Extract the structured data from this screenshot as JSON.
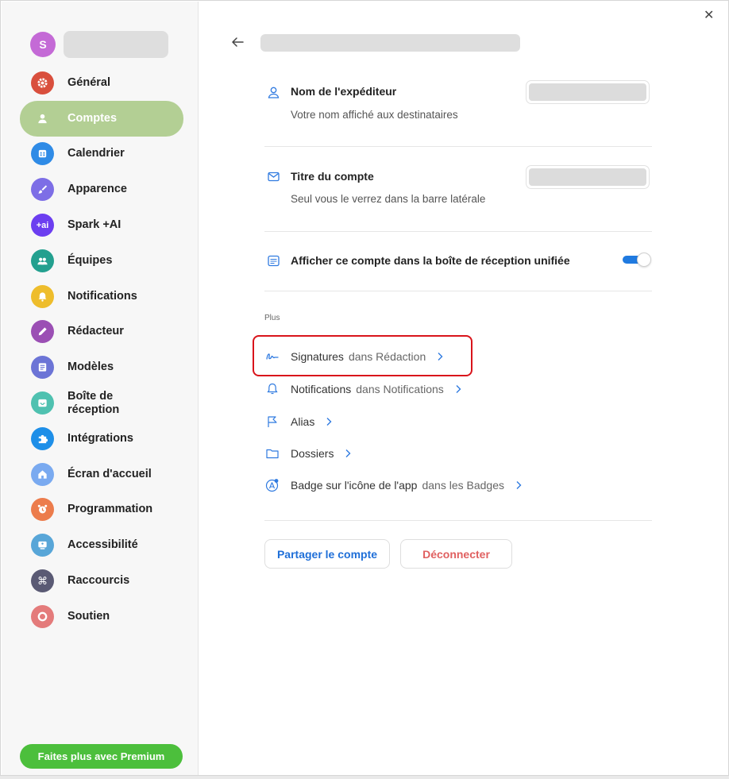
{
  "user": {
    "initial": "S"
  },
  "sidebar": {
    "items": [
      {
        "label": "Général",
        "icon": "gear-icon",
        "color": "#d94f3d"
      },
      {
        "label": "Comptes",
        "icon": "person-icon",
        "color": "#b3cf94",
        "active": true
      },
      {
        "label": "Calendrier",
        "icon": "calendar-icon",
        "color": "#2f8be6"
      },
      {
        "label": "Apparence",
        "icon": "paint-brush-icon",
        "color": "#7d6ee6"
      },
      {
        "label": "Spark +AI",
        "icon": "ai-icon",
        "text": "+ai",
        "color": "#6c3ef0"
      },
      {
        "label": "Équipes",
        "icon": "team-icon",
        "color": "#23a08f"
      },
      {
        "label": "Notifications",
        "icon": "bell-icon",
        "color": "#eebd2c"
      },
      {
        "label": "Rédacteur",
        "icon": "pencil-icon",
        "color": "#9b4fb4"
      },
      {
        "label": "Modèles",
        "icon": "template-icon",
        "color": "#6c74d6"
      },
      {
        "label": "Boîte de\nréception",
        "icon": "inbox-icon",
        "color": "#4fc1b0"
      },
      {
        "label": "Intégrations",
        "icon": "puzzle-icon",
        "color": "#1e8fe8"
      },
      {
        "label": "Écran d'accueil",
        "icon": "home-icon",
        "color": "#7aaaf0"
      },
      {
        "label": "Programmation",
        "icon": "alarm-clock-icon",
        "color": "#ec7c4c"
      },
      {
        "label": "Accessibilité",
        "icon": "accessibility-icon",
        "color": "#58a6d8"
      },
      {
        "label": "Raccourcis",
        "icon": "command-icon",
        "color": "#5a5a74"
      },
      {
        "label": "Soutien",
        "icon": "support-icon",
        "color": "#e47b7b"
      }
    ],
    "premium_label": "Faites plus avec Premium"
  },
  "account": {
    "sender_name": {
      "title": "Nom de l'expéditeur",
      "subtitle": "Votre nom affiché aux destinataires"
    },
    "account_title": {
      "title": "Titre du compte",
      "subtitle": "Seul vous le verrez dans la barre latérale"
    },
    "unified_inbox": {
      "label": "Afficher ce compte dans la boîte de réception unifiée",
      "enabled": true
    }
  },
  "more": {
    "section_label": "Plus",
    "links": [
      {
        "main": "Signatures",
        "sub": "dans Rédaction",
        "icon": "signature-icon"
      },
      {
        "main": "Notifications",
        "sub": "dans Notifications",
        "icon": "bell-icon"
      },
      {
        "main": "Alias",
        "sub": "",
        "icon": "alias-icon"
      },
      {
        "main": "Dossiers",
        "sub": "",
        "icon": "folder-icon"
      },
      {
        "main": "Badge sur l'icône de l'app",
        "sub": "dans les Badges",
        "icon": "badge-icon"
      }
    ]
  },
  "actions": {
    "share_label": "Partager le compte",
    "logout_label": "Déconnecter"
  },
  "colors": {
    "accent": "#1f7ae0",
    "active_nav": "#b3cf94",
    "premium": "#4cbf3c",
    "danger": "#e06060",
    "highlight": "#d9141b"
  }
}
